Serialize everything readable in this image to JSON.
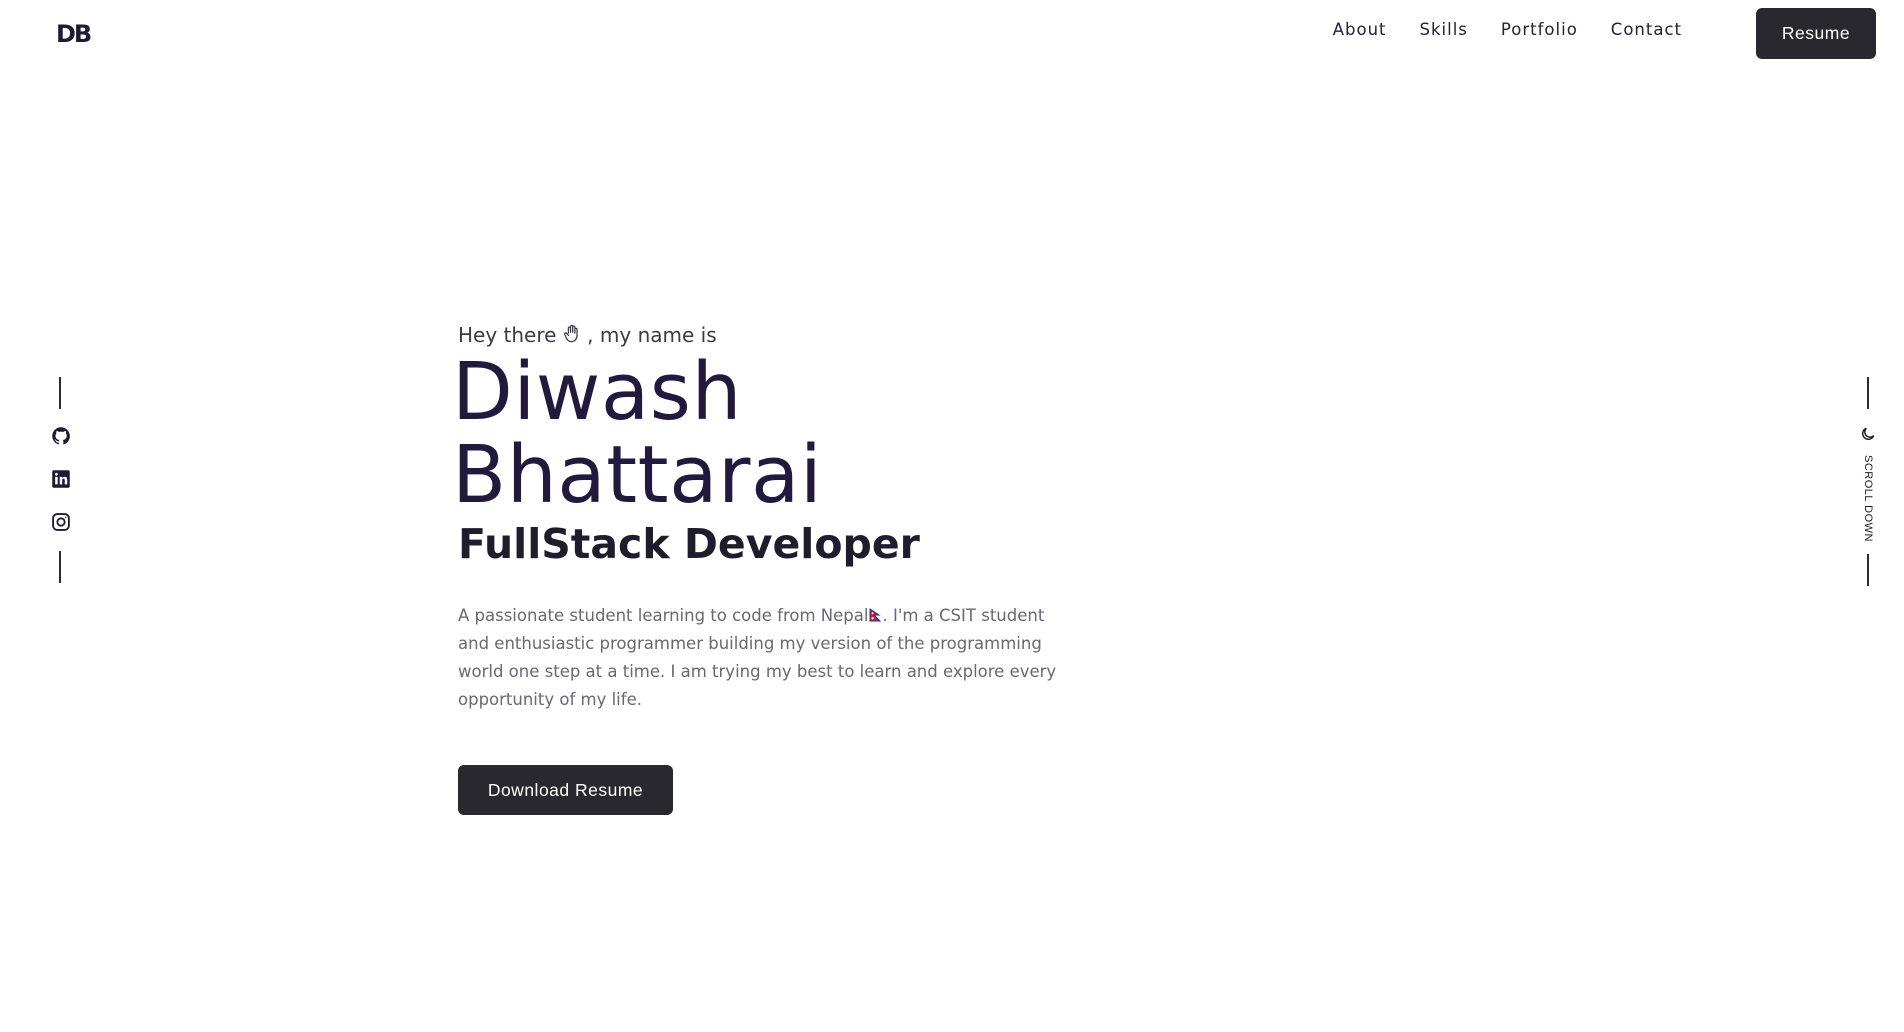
{
  "header": {
    "logo": "DB",
    "nav": [
      "About",
      "Skills",
      "Portfolio",
      "Contact"
    ],
    "resume_label": "Resume"
  },
  "social": {
    "icons": [
      "github-icon",
      "linkedin-icon",
      "instagram-icon"
    ]
  },
  "right_rail": {
    "theme_icon": "moon-icon",
    "scroll_label": "SCROLL DOWN"
  },
  "hero": {
    "greeting_pre": "Hey there ",
    "greeting_post": ", my name is",
    "name": "Diwash Bhattarai",
    "role": "FullStack Developer",
    "bio_pre": "A passionate student learning to code from Nepal",
    "bio_post": ". I'm a CSIT student and enthusiastic programmer building my version of the programming world one step at a time. I am trying my best to learn and explore every opportunity of my life.",
    "download_label": "Download Resume"
  },
  "colors": {
    "dark_button": "#29282f",
    "name_color": "#221a3d",
    "body_text": "#6a6674"
  }
}
